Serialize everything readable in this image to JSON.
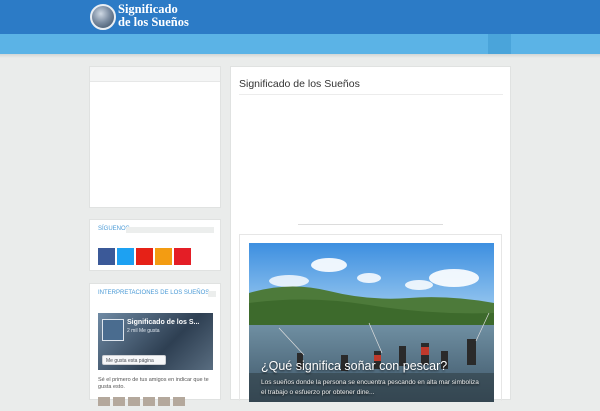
{
  "header": {
    "logo_line1": "Significado",
    "logo_line2": "de los Sueños"
  },
  "main": {
    "title": "Significado de los Sueños",
    "post": {
      "title": "¿Qué significa soñar con pescar?",
      "excerpt": "Los sueños donde la persona se encuentra pescando en alta mar simboliza el trabajo o esfuerzo por obtener dine..."
    }
  },
  "sidebar": {
    "follow_title": "SÍGUENOS",
    "social": [
      {
        "name": "facebook",
        "color": "#3b5998"
      },
      {
        "name": "twitter",
        "color": "#1da1f2"
      },
      {
        "name": "youtube",
        "color": "#e62117"
      },
      {
        "name": "rss",
        "color": "#f39c12"
      },
      {
        "name": "pinterest",
        "color": "#e41e26"
      }
    ],
    "interp_title": "INTERPRETACIONES DE LOS SUEÑOS",
    "fb_widget": {
      "page_name": "Significado de los S...",
      "page_sub": "2 mil Me gusta",
      "like_label": "Me gusta esta página",
      "friends_text": "Sé el primero de tus amigos en indicar que te gusta esto."
    }
  },
  "colors": {
    "topbar": "#2c7bc6",
    "navbar": "#5bb3e6",
    "accent": "#4a9ad6"
  }
}
